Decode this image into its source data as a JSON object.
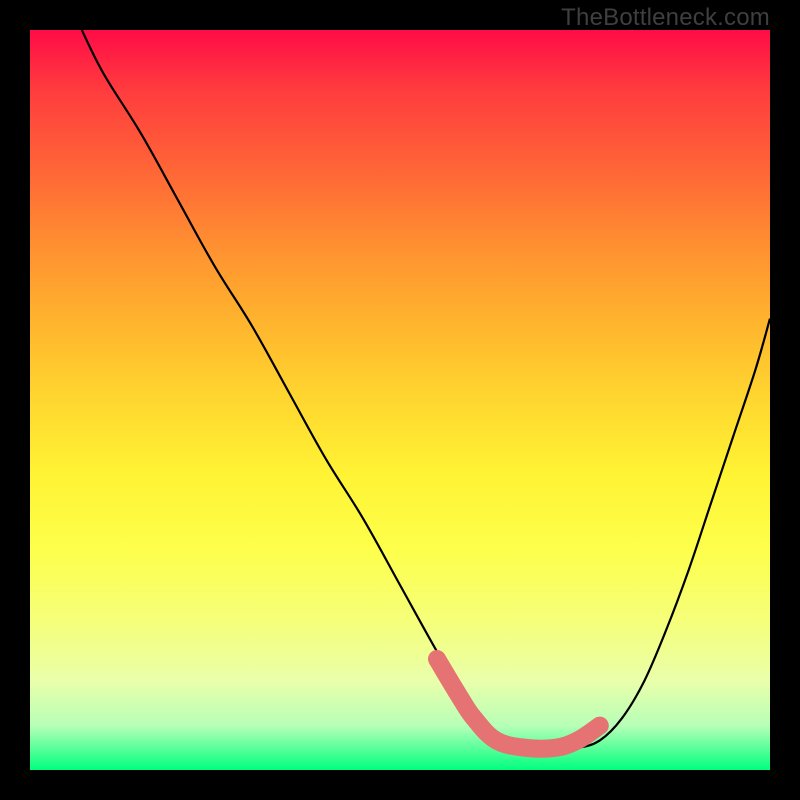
{
  "watermark": "TheBottleneck.com",
  "colors": {
    "background": "#000000",
    "curve_stroke": "#000000",
    "marker_stroke": "#e57373",
    "gradient_top": "#ff0c47",
    "gradient_bottom": "#00ff7f"
  },
  "chart_data": {
    "type": "line",
    "title": "",
    "xlabel": "",
    "ylabel": "",
    "xlim": [
      0,
      100
    ],
    "ylim": [
      0,
      100
    ],
    "series": [
      {
        "name": "bottleneck-curve",
        "x": [
          7,
          10,
          15,
          20,
          25,
          30,
          35,
          40,
          45,
          50,
          55,
          58,
          60,
          63,
          67,
          71,
          74,
          77,
          80,
          83,
          86,
          89,
          92,
          95,
          98,
          100
        ],
        "y": [
          100,
          94,
          86,
          77,
          68,
          60,
          51,
          42,
          34,
          25,
          16,
          11,
          8,
          5,
          3,
          3,
          3,
          4,
          7,
          12,
          19,
          27,
          36,
          45,
          54,
          61
        ]
      }
    ],
    "marker": {
      "name": "optimal-range",
      "x": [
        55,
        58,
        60,
        63,
        67,
        71,
        74,
        77
      ],
      "y": [
        15,
        10,
        7,
        4,
        3,
        3,
        4,
        6
      ]
    }
  }
}
